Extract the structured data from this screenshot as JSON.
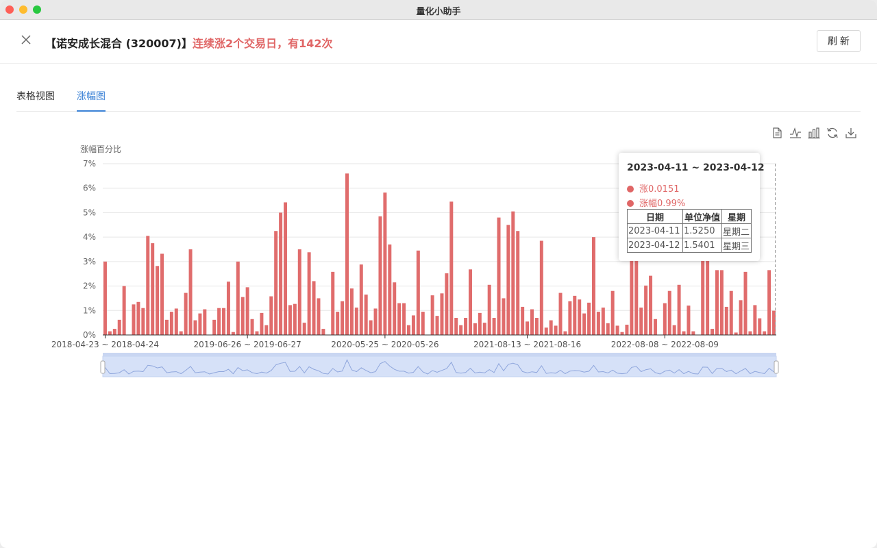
{
  "window": {
    "title": "量化小助手"
  },
  "header": {
    "fund": "【诺安成长混合 (320007)】",
    "alert": "连续涨2个交易日，有142次",
    "refresh_label": "刷 新"
  },
  "tabs": [
    {
      "label": "表格视图"
    },
    {
      "label": "涨幅图"
    }
  ],
  "toolbox": [
    "data-view-icon",
    "line-chart-icon",
    "bar-chart-icon",
    "restore-icon",
    "download-icon"
  ],
  "tooltip": {
    "title": "2023-04-11 ~ 2023-04-12",
    "rise": "涨0.0151",
    "pct": "涨幅0.99%",
    "headers": [
      "日期",
      "单位净值",
      "星期"
    ],
    "rows": [
      [
        "2023-04-11",
        "1.5250",
        "星期二"
      ],
      [
        "2023-04-12",
        "1.5401",
        "星期三"
      ]
    ]
  },
  "colors": {
    "bar": "#e06c6c",
    "accent": "#3b82d6",
    "zoom_fill": "#d6e1f8"
  },
  "chart_data": {
    "type": "bar",
    "ylabel": "涨幅百分比",
    "ylim": [
      0,
      7
    ],
    "yticks": [
      "0%",
      "1%",
      "2%",
      "3%",
      "4%",
      "5%",
      "6%",
      "7%"
    ],
    "xtick_labels": [
      {
        "index": 0,
        "label": "2018-04-23 ~ 2018-04-24"
      },
      {
        "index": 30,
        "label": "2019-06-26 ~ 2019-06-27"
      },
      {
        "index": 59,
        "label": "2020-05-25 ~ 2020-05-26"
      },
      {
        "index": 89,
        "label": "2021-08-13 ~ 2021-08-16"
      },
      {
        "index": 118,
        "label": "2022-08-08 ~ 2022-08-09"
      }
    ],
    "values": [
      3.0,
      0.15,
      0.25,
      0.62,
      2.0,
      0,
      1.25,
      1.35,
      1.1,
      4.05,
      3.75,
      2.82,
      3.32,
      0.62,
      0.95,
      1.08,
      0.15,
      1.72,
      3.5,
      0.6,
      0.88,
      1.05,
      0,
      0.62,
      1.1,
      1.1,
      2.18,
      0.12,
      3.0,
      1.55,
      1.95,
      0.65,
      0.15,
      0.9,
      0.4,
      1.58,
      4.25,
      5.0,
      5.42,
      1.22,
      1.27,
      3.5,
      0.5,
      3.38,
      2.2,
      1.5,
      0.25,
      0,
      2.58,
      0.95,
      1.38,
      6.6,
      1.9,
      1.12,
      2.88,
      1.65,
      0.6,
      1.08,
      4.85,
      5.82,
      3.7,
      2.15,
      1.3,
      1.3,
      0.4,
      0.8,
      3.45,
      0.95,
      0,
      1.62,
      0.78,
      1.7,
      2.52,
      5.45,
      0.7,
      0.4,
      0.7,
      2.68,
      0.48,
      0.9,
      0.5,
      2.05,
      0.7,
      4.8,
      1.5,
      4.5,
      5.05,
      4.25,
      1.15,
      0.55,
      1.05,
      0.7,
      3.85,
      0.3,
      0.6,
      0.38,
      1.72,
      0.15,
      1.38,
      1.6,
      1.45,
      0.88,
      1.32,
      4.0,
      0.95,
      1.12,
      0.48,
      1.8,
      0.38,
      0.12,
      0.42,
      3.1,
      3.5,
      1.12,
      2.02,
      2.42,
      0.65,
      0,
      1.3,
      1.8,
      0.4,
      2.05,
      0.15,
      1.2,
      0.15,
      0,
      3.2,
      3.15,
      0.25,
      2.65,
      2.65,
      1.15,
      1.8,
      0.1,
      1.42,
      2.58,
      0.15,
      1.22,
      0.68,
      0.15,
      2.65,
      0.99
    ]
  }
}
